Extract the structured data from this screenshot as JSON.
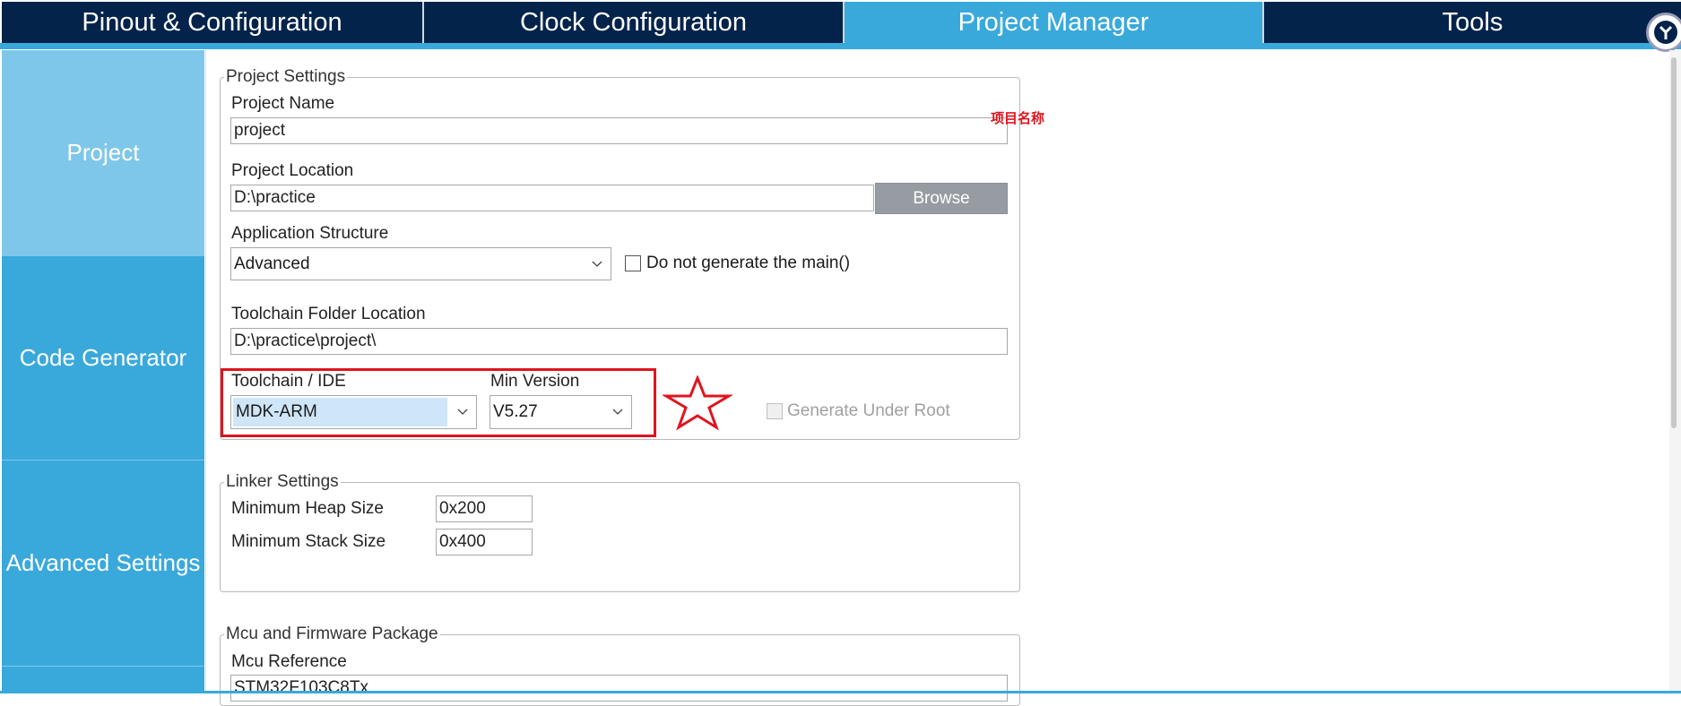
{
  "tabs": [
    {
      "label": "Pinout & Configuration",
      "active": false
    },
    {
      "label": "Clock Configuration",
      "active": false
    },
    {
      "label": "Project Manager",
      "active": true
    },
    {
      "label": "Tools",
      "active": false
    }
  ],
  "sidebar": {
    "items": [
      {
        "label": "Project",
        "active": true
      },
      {
        "label": "Code Generator",
        "active": false
      },
      {
        "label": "Advanced Settings",
        "active": false
      }
    ]
  },
  "project_settings": {
    "title": "Project Settings",
    "project_name_label": "Project Name",
    "project_name_value": "project",
    "project_location_label": "Project Location",
    "project_location_value": "D:\\practice",
    "browse_label": "Browse",
    "app_structure_label": "Application Structure",
    "app_structure_value": "Advanced",
    "no_main_label": "Do not generate the main()",
    "no_main_checked": false,
    "toolchain_folder_label": "Toolchain Folder Location",
    "toolchain_folder_value": "D:\\practice\\project\\",
    "toolchain_ide_label": "Toolchain / IDE",
    "toolchain_ide_value": "MDK-ARM",
    "min_version_label": "Min Version",
    "min_version_value": "V5.27",
    "generate_under_root_label": "Generate Under Root",
    "generate_under_root_enabled": false
  },
  "linker_settings": {
    "title": "Linker Settings",
    "heap_label": "Minimum Heap Size",
    "heap_value": "0x200",
    "stack_label": "Minimum Stack Size",
    "stack_value": "0x400"
  },
  "mcu_package": {
    "title": "Mcu and Firmware Package",
    "mcu_reference_label": "Mcu Reference",
    "mcu_reference_value": "STM32F103C8Tx"
  },
  "annotations": {
    "project_name_note": "项目名称",
    "color": "#e0141e"
  },
  "colors": {
    "tab_dark": "#03234b",
    "accent": "#39a9dc",
    "sidebar_active": "#7fc7ea",
    "browse_button": "#979ca2"
  }
}
